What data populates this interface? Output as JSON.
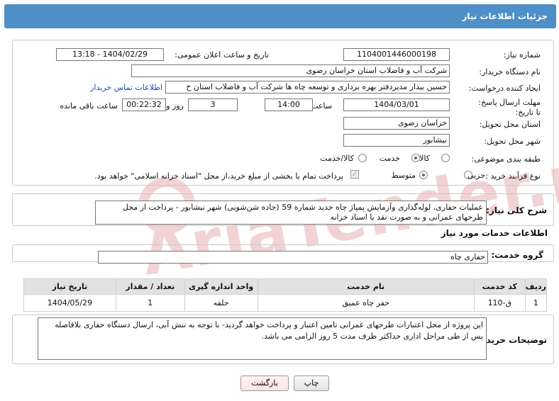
{
  "header": {
    "title": "جزئیات اطلاعات نیاز"
  },
  "form": {
    "need_number_label": "شماره نیاز:",
    "need_number": "1104001446000198",
    "announce_label": "تاریخ و ساعت اعلان عمومی:",
    "announce_value": "1404/02/29 - 13:18",
    "buyer_org_label": "نام دستگاه خریدار:",
    "buyer_org": "شرکت آب و فاضلاب استان خراسان رضوی",
    "creator_label": "ایجاد کننده درخواست:",
    "creator": "حسین  بیدار مدیردفتر بهره برداری و توسعه چاه ها شرکت آب و فاضلاب استان خ",
    "contact_link": "اطلاعات تماس خریدار",
    "deadline_label": "مهلت ارسال پاسخ: تا تاریخ:",
    "deadline_date": "1404/03/01",
    "time_label": "ساعت",
    "deadline_time": "14:00",
    "day_count": "3",
    "day_label": "روز و",
    "remaining_time": "00:22:32",
    "remaining_label": "ساعت باقی مانده",
    "province_label": "استان محل تحویل:",
    "province": "خراسان رضوی",
    "city_label": "شهر محل تحویل:",
    "city": "نیشابور",
    "category_label": "طبقه بندی موضوعی:",
    "category_options": [
      "کالا",
      "خدمت",
      "کالا/خدمت"
    ],
    "category_selected": "خدمت",
    "process_label": "نوع فرآیند خرید :",
    "process_options": [
      "جزیی",
      "متوسط"
    ],
    "process_selected": "متوسط",
    "payment_note": "پرداخت تمام یا بخشی از مبلغ خرید،از محل \"اسناد خزانه اسلامی\" خواهد بود."
  },
  "summary": {
    "label": "شرح کلی نیاز:",
    "text": "عملیات حفاری، لوله‌گذاری وآزمایش پمپاژ چاه جدید شماره 59 (جاده شن‌شویی) شهر نیشابور - پرداخت از محل طرحهای عمرانی و به صورت نقد یا اسناد خزانه"
  },
  "services": {
    "section_title": "اطلاعات خدمات مورد نیاز",
    "group_label": "گروه خدمت:",
    "group_value": "حفاری چاه",
    "columns": [
      "ردیف",
      "کد خدمت",
      "نام خدمت",
      "واحد اندازه گیری",
      "تعداد / مقدار",
      "تاریخ نیاز"
    ],
    "rows": [
      {
        "row": "1",
        "code": "ق-110",
        "name": "حفر چاه عمیق",
        "unit": "حلقه",
        "qty": "1",
        "date": "1404/05/29"
      }
    ]
  },
  "buyer_notes": {
    "label": "توضیحات خریدار:",
    "text": "این پروژه از محل اعتبارات طرحهای عمرانی تامین اعتبار و پرداخت خواهد گردید- با توجه به تنش آبی، ارسال دستگاه حفاری بلافاصله پس از طی مراحل اداری حداکثر ظرف مدت 5 روز الزامی می باشد."
  },
  "buttons": {
    "print": "چاپ",
    "back": "بازگشت"
  },
  "watermark": "AriaTender.neT",
  "colors": {
    "header_bg": "#4d8fc6",
    "link": "#1a4db3",
    "back_button_bg": "#fde4e4"
  }
}
